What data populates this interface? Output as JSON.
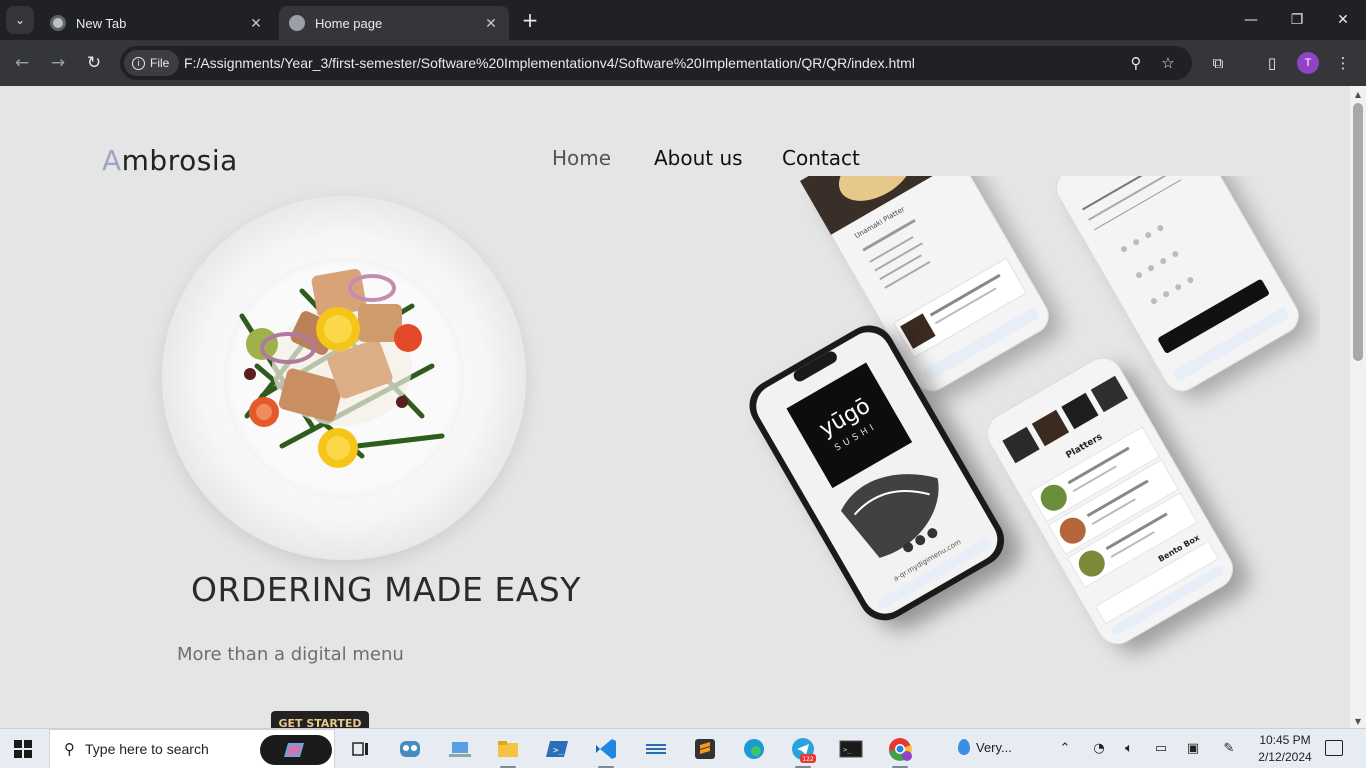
{
  "browser": {
    "tabs": [
      {
        "title": "New Tab",
        "active": false
      },
      {
        "title": "Home page",
        "active": true
      }
    ],
    "chip_label": "File",
    "url": "F:/Assignments/Year_3/first-semester/Software%20Implementationv4/Software%20Implementation/QR/QR/index.html",
    "profile_initial": "T"
  },
  "page": {
    "logo_first": "A",
    "logo_rest": "mbrosia",
    "nav": [
      "Home",
      "About us",
      "Contact"
    ],
    "hero_title": "ORDERING MADE EASY",
    "hero_subtitle": "More than a digital menu",
    "cta_label": "GET STARTED",
    "mockup": {
      "brand_title": "yūgō",
      "brand_sub": "SUSHI",
      "menu_heading": "Platters",
      "menu_section": "Bento Box",
      "dish_title": "Unamaki Platter",
      "site": "a-qr.mydigimenu.com"
    }
  },
  "taskbar": {
    "search_placeholder": "Type here to search",
    "weather_text": "Very...",
    "time": "10:45 PM",
    "date": "2/12/2024",
    "telegram_badge": "122"
  },
  "colors": {
    "page_bg": "#e5e5e5",
    "logo_accent": "#9aa6c0",
    "cta_bg": "#222222",
    "cta_text": "#e8c78a",
    "chrome_dark": "#202124",
    "chrome_toolbar": "#35363a"
  }
}
